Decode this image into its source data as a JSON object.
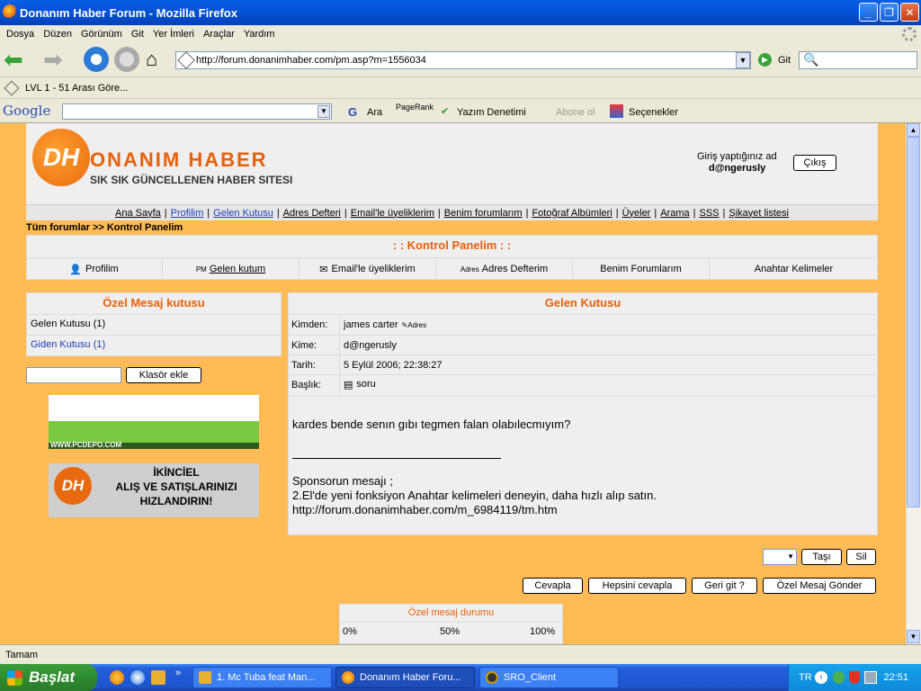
{
  "window": {
    "title": "Donanım Haber Forum  -  Mozilla Firefox"
  },
  "menu": [
    "Dosya",
    "Düzen",
    "Görünüm",
    "Git",
    "Yer İmleri",
    "Araçlar",
    "Yardım"
  ],
  "nav": {
    "url": "http://forum.donanimhaber.com/pm.asp?m=1556034",
    "go_label": "Git"
  },
  "bookmarks": {
    "item": "LVL 1 - 51 Arası Göre..."
  },
  "googlebar": {
    "brand": "Google",
    "search_label": "Ara",
    "pagerank": "PageRank",
    "spell": "Yazım Denetimi",
    "subscribe": "Abone ol",
    "options": "Seçenekler"
  },
  "site": {
    "logo_main": "ONANIM HABER",
    "logo_sub": "SIK SIK GÜNCELLENEN HABER SITESI",
    "login_label": "Giriş yaptığınız ad",
    "username": "d@ngerusly",
    "logout": "Çıkış",
    "topnav": [
      "Ana Sayfa",
      "Profilim",
      "Gelen Kutusu",
      "Adres Defteri",
      "Email'le üyeliklerim",
      "Benim forumlarım",
      "Fotoğraf Albümleri",
      "Üyeler",
      "Arama",
      "SSS",
      "Şikayet listesi"
    ],
    "breadcrumb": "Tüm forumlar >> Kontrol Panelim"
  },
  "panel": {
    "title": ": : Kontrol Panelim : :",
    "tabs": [
      "Profilim",
      "Gelen kutum",
      "Email'le üyeliklerim",
      "Adres Defterim",
      "Benim Forumlarım",
      "Anahtar Kelimeler"
    ],
    "pm_tag": "PM",
    "adres_tag": "Adres"
  },
  "sidebar": {
    "title": "Özel Mesaj kutusu",
    "inbox": "Gelen Kutusu (1)",
    "outbox": "Giden Kutusu (1)",
    "add_folder": "Klasör ekle",
    "banner_url": "WWW.PCDEPO.COM",
    "ad_line1": "İKİNCİEL",
    "ad_line2": "ALIŞ VE SATIŞLARINIZI",
    "ad_line3": "HIZLANDIRIN!"
  },
  "message": {
    "title": "Gelen Kutusu",
    "from_label": "Kimden:",
    "from": "james carter",
    "adres": "Adres",
    "to_label": "Kime:",
    "to": "d@ngerusly",
    "date_label": "Tarih:",
    "date": "5 Eylül 2006; 22:38:27",
    "subject_label": "Başlık:",
    "subject": "soru",
    "body": "kardes bende senın gıbı tegmen falan olabılecmıyım?",
    "sponsor": "Sponsorun mesajı ;",
    "sponsor_text": "2.El'de yeni fonksiyon Anahtar kelimeleri deneyin, daha hızlı alıp satın.",
    "sponsor_url": "http://forum.donanimhaber.com/m_6984119/tm.htm"
  },
  "actions": {
    "move": "Taşı",
    "delete": "Sil",
    "reply": "Cevapla",
    "reply_all": "Hepsini cevapla",
    "back": "Geri git ?",
    "send": "Özel Mesaj Gönder"
  },
  "pm_status": {
    "title": "Özel mesaj durumu",
    "p0": "0%",
    "p50": "50%",
    "p100": "100%"
  },
  "status": {
    "text": "Tamam"
  },
  "taskbar": {
    "start": "Başlat",
    "tasks": [
      "1. Mc Tuba feat Man...",
      "Donanım Haber Foru...",
      "SRO_Client"
    ],
    "lang": "TR",
    "clock": "22:51"
  },
  "colors": {
    "accent": "#e8600a",
    "page_bg": "#ffbb55",
    "panel_bg": "#efefef"
  }
}
